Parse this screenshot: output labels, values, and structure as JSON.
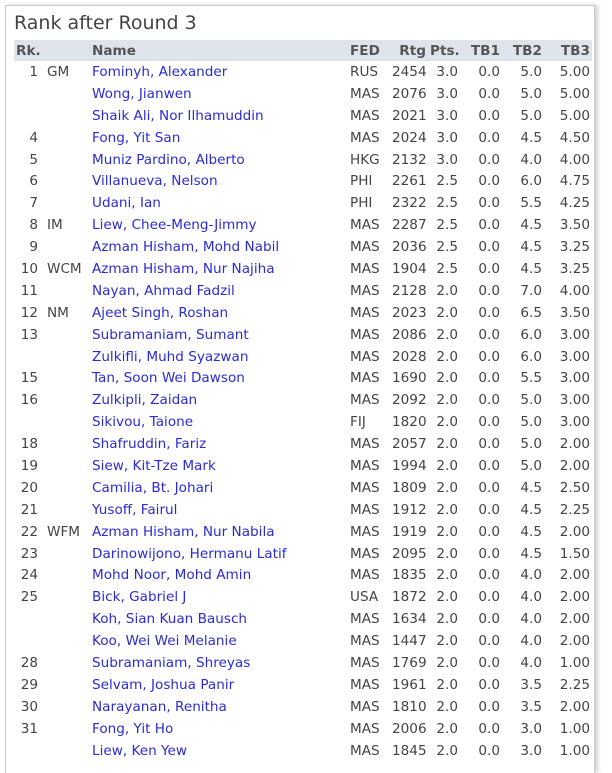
{
  "title": "Rank after Round 3",
  "headers": {
    "rank": "Rk.",
    "title": "",
    "name": "Name",
    "fed": "FED",
    "rtg": "Rtg",
    "pts": "Pts.",
    "tb1": "TB1",
    "tb2": "TB2",
    "tb3": "TB3"
  },
  "rows": [
    {
      "rank": "1",
      "title": "GM",
      "name": "Fominyh, Alexander",
      "fed": "RUS",
      "rtg": "2454",
      "pts": "3.0",
      "tb1": "0.0",
      "tb2": "5.0",
      "tb3": "5.00"
    },
    {
      "rank": "",
      "title": "",
      "name": "Wong, Jianwen",
      "fed": "MAS",
      "rtg": "2076",
      "pts": "3.0",
      "tb1": "0.0",
      "tb2": "5.0",
      "tb3": "5.00"
    },
    {
      "rank": "",
      "title": "",
      "name": "Shaik Ali, Nor Ilhamuddin",
      "fed": "MAS",
      "rtg": "2021",
      "pts": "3.0",
      "tb1": "0.0",
      "tb2": "5.0",
      "tb3": "5.00"
    },
    {
      "rank": "4",
      "title": "",
      "name": "Fong, Yit San",
      "fed": "MAS",
      "rtg": "2024",
      "pts": "3.0",
      "tb1": "0.0",
      "tb2": "4.5",
      "tb3": "4.50"
    },
    {
      "rank": "5",
      "title": "",
      "name": "Muniz Pardino, Alberto",
      "fed": "HKG",
      "rtg": "2132",
      "pts": "3.0",
      "tb1": "0.0",
      "tb2": "4.0",
      "tb3": "4.00"
    },
    {
      "rank": "6",
      "title": "",
      "name": "Villanueva, Nelson",
      "fed": "PHI",
      "rtg": "2261",
      "pts": "2.5",
      "tb1": "0.0",
      "tb2": "6.0",
      "tb3": "4.75"
    },
    {
      "rank": "7",
      "title": "",
      "name": "Udani, Ian",
      "fed": "PHI",
      "rtg": "2322",
      "pts": "2.5",
      "tb1": "0.0",
      "tb2": "5.5",
      "tb3": "4.25"
    },
    {
      "rank": "8",
      "title": "IM",
      "name": "Liew, Chee-Meng-Jimmy",
      "fed": "MAS",
      "rtg": "2287",
      "pts": "2.5",
      "tb1": "0.0",
      "tb2": "4.5",
      "tb3": "3.50"
    },
    {
      "rank": "9",
      "title": "",
      "name": "Azman Hisham, Mohd Nabil",
      "fed": "MAS",
      "rtg": "2036",
      "pts": "2.5",
      "tb1": "0.0",
      "tb2": "4.5",
      "tb3": "3.25"
    },
    {
      "rank": "10",
      "title": "WCM",
      "name": "Azman Hisham, Nur Najiha",
      "fed": "MAS",
      "rtg": "1904",
      "pts": "2.5",
      "tb1": "0.0",
      "tb2": "4.5",
      "tb3": "3.25"
    },
    {
      "rank": "11",
      "title": "",
      "name": "Nayan, Ahmad Fadzil",
      "fed": "MAS",
      "rtg": "2128",
      "pts": "2.0",
      "tb1": "0.0",
      "tb2": "7.0",
      "tb3": "4.00"
    },
    {
      "rank": "12",
      "title": "NM",
      "name": "Ajeet Singh, Roshan",
      "fed": "MAS",
      "rtg": "2023",
      "pts": "2.0",
      "tb1": "0.0",
      "tb2": "6.5",
      "tb3": "3.50"
    },
    {
      "rank": "13",
      "title": "",
      "name": "Subramaniam, Sumant",
      "fed": "MAS",
      "rtg": "2086",
      "pts": "2.0",
      "tb1": "0.0",
      "tb2": "6.0",
      "tb3": "3.00"
    },
    {
      "rank": "",
      "title": "",
      "name": "Zulkifli, Muhd Syazwan",
      "fed": "MAS",
      "rtg": "2028",
      "pts": "2.0",
      "tb1": "0.0",
      "tb2": "6.0",
      "tb3": "3.00"
    },
    {
      "rank": "15",
      "title": "",
      "name": "Tan, Soon Wei Dawson",
      "fed": "MAS",
      "rtg": "1690",
      "pts": "2.0",
      "tb1": "0.0",
      "tb2": "5.5",
      "tb3": "3.00"
    },
    {
      "rank": "16",
      "title": "",
      "name": "Zulkipli, Zaidan",
      "fed": "MAS",
      "rtg": "2092",
      "pts": "2.0",
      "tb1": "0.0",
      "tb2": "5.0",
      "tb3": "3.00"
    },
    {
      "rank": "",
      "title": "",
      "name": "Sikivou, Taione",
      "fed": "FIJ",
      "rtg": "1820",
      "pts": "2.0",
      "tb1": "0.0",
      "tb2": "5.0",
      "tb3": "3.00"
    },
    {
      "rank": "18",
      "title": "",
      "name": "Shafruddin, Fariz",
      "fed": "MAS",
      "rtg": "2057",
      "pts": "2.0",
      "tb1": "0.0",
      "tb2": "5.0",
      "tb3": "2.00"
    },
    {
      "rank": "19",
      "title": "",
      "name": "Siew, Kit-Tze Mark",
      "fed": "MAS",
      "rtg": "1994",
      "pts": "2.0",
      "tb1": "0.0",
      "tb2": "5.0",
      "tb3": "2.00"
    },
    {
      "rank": "20",
      "title": "",
      "name": "Camilia, Bt. Johari",
      "fed": "MAS",
      "rtg": "1809",
      "pts": "2.0",
      "tb1": "0.0",
      "tb2": "4.5",
      "tb3": "2.50"
    },
    {
      "rank": "21",
      "title": "",
      "name": "Yusoff, Fairul",
      "fed": "MAS",
      "rtg": "1912",
      "pts": "2.0",
      "tb1": "0.0",
      "tb2": "4.5",
      "tb3": "2.25"
    },
    {
      "rank": "22",
      "title": "WFM",
      "name": "Azman Hisham, Nur Nabila",
      "fed": "MAS",
      "rtg": "1919",
      "pts": "2.0",
      "tb1": "0.0",
      "tb2": "4.5",
      "tb3": "2.00"
    },
    {
      "rank": "23",
      "title": "",
      "name": "Darinowijono, Hermanu Latif",
      "fed": "MAS",
      "rtg": "2095",
      "pts": "2.0",
      "tb1": "0.0",
      "tb2": "4.5",
      "tb3": "1.50"
    },
    {
      "rank": "24",
      "title": "",
      "name": "Mohd Noor, Mohd Amin",
      "fed": "MAS",
      "rtg": "1835",
      "pts": "2.0",
      "tb1": "0.0",
      "tb2": "4.0",
      "tb3": "2.00"
    },
    {
      "rank": "25",
      "title": "",
      "name": "Bick, Gabriel J",
      "fed": "USA",
      "rtg": "1872",
      "pts": "2.0",
      "tb1": "0.0",
      "tb2": "4.0",
      "tb3": "2.00"
    },
    {
      "rank": "",
      "title": "",
      "name": "Koh, Sian Kuan Bausch",
      "fed": "MAS",
      "rtg": "1634",
      "pts": "2.0",
      "tb1": "0.0",
      "tb2": "4.0",
      "tb3": "2.00"
    },
    {
      "rank": "",
      "title": "",
      "name": "Koo, Wei Wei Melanie",
      "fed": "MAS",
      "rtg": "1447",
      "pts": "2.0",
      "tb1": "0.0",
      "tb2": "4.0",
      "tb3": "2.00"
    },
    {
      "rank": "28",
      "title": "",
      "name": "Subramaniam, Shreyas",
      "fed": "MAS",
      "rtg": "1769",
      "pts": "2.0",
      "tb1": "0.0",
      "tb2": "4.0",
      "tb3": "1.00"
    },
    {
      "rank": "29",
      "title": "",
      "name": "Selvam, Joshua Panir",
      "fed": "MAS",
      "rtg": "1961",
      "pts": "2.0",
      "tb1": "0.0",
      "tb2": "3.5",
      "tb3": "2.25"
    },
    {
      "rank": "30",
      "title": "",
      "name": "Narayanan, Renitha",
      "fed": "MAS",
      "rtg": "1810",
      "pts": "2.0",
      "tb1": "0.0",
      "tb2": "3.5",
      "tb3": "2.00"
    },
    {
      "rank": "31",
      "title": "",
      "name": "Fong, Yit Ho",
      "fed": "MAS",
      "rtg": "2006",
      "pts": "2.0",
      "tb1": "0.0",
      "tb2": "3.0",
      "tb3": "1.00"
    },
    {
      "rank": "",
      "title": "",
      "name": "Liew, Ken Yew",
      "fed": "MAS",
      "rtg": "1845",
      "pts": "2.0",
      "tb1": "0.0",
      "tb2": "3.0",
      "tb3": "1.00"
    }
  ]
}
